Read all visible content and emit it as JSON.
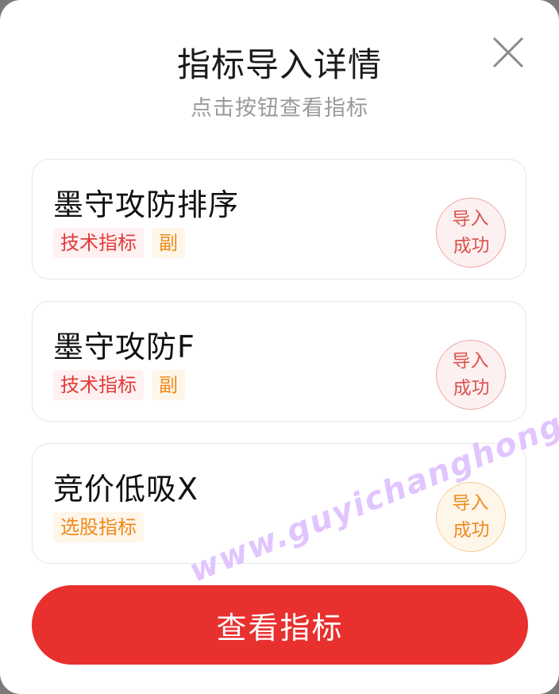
{
  "dialog": {
    "title": "指标导入详情",
    "subtitle": "点击按钮查看指标",
    "close_icon": "close-icon"
  },
  "cards": [
    {
      "title": "墨守攻防排序",
      "tags": [
        {
          "label": "技术指标",
          "color": "#e23a3a"
        },
        {
          "label": "副",
          "color": "#ee8a1c"
        }
      ],
      "status_line1": "导入",
      "status_line2": "成功",
      "status_color": "#d9534f"
    },
    {
      "title": "墨守攻防F",
      "tags": [
        {
          "label": "技术指标",
          "color": "#e23a3a"
        },
        {
          "label": "副",
          "color": "#ee8a1c"
        }
      ],
      "status_line1": "导入",
      "status_line2": "成功",
      "status_color": "#d9534f"
    },
    {
      "title": "竞价低吸X",
      "tags": [
        {
          "label": "选股指标",
          "color": "#ee8a1c"
        }
      ],
      "status_line1": "导入",
      "status_line2": "成功",
      "status_color": "#ee8a1c"
    }
  ],
  "button": {
    "label": "查看指标",
    "color": "#e8302f"
  },
  "watermark": "www.guyichanghong.com"
}
